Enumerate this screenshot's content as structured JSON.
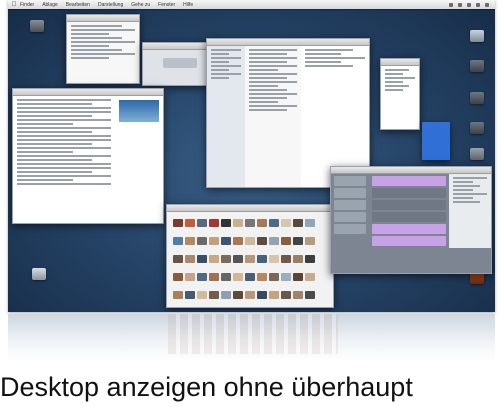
{
  "menubar": {
    "items": [
      "Finder",
      "Ablage",
      "Bearbeiten",
      "Darstellung",
      "Gehe zu",
      "Fenster",
      "Hilfe"
    ]
  },
  "windows": [
    {
      "name": "text-editor-window"
    },
    {
      "name": "finder-list-window"
    },
    {
      "name": "small-panel-window"
    },
    {
      "name": "notes-window"
    },
    {
      "name": "dialog-window"
    },
    {
      "name": "document-window"
    },
    {
      "name": "photo-browser-window"
    },
    {
      "name": "audio-editor-window"
    }
  ],
  "caption": {
    "text": "Desktop anzeigen ohne überhaupt"
  },
  "colors": {
    "desktop": "#27466a",
    "audio_track": "#c8a2e6",
    "blue_widget": "#2f6fd6"
  }
}
